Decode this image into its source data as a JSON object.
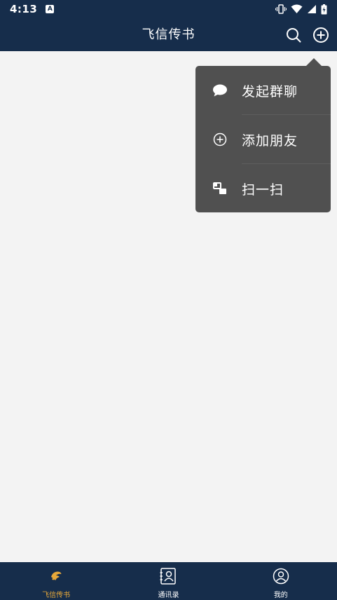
{
  "status_bar": {
    "time": "4:13",
    "notification_icon": "A",
    "icons": [
      "vibrate-icon",
      "wifi-icon",
      "signal-icon",
      "battery-icon"
    ]
  },
  "app_bar": {
    "title": "飞信传书",
    "actions": [
      "search-icon",
      "add-circle-icon"
    ],
    "background": "#162d4b"
  },
  "popup_menu": {
    "background": "#505050",
    "items": [
      {
        "label": "发起群聊",
        "icon": "chat-bubble-icon"
      },
      {
        "label": "添加朋友",
        "icon": "add-circle-icon"
      },
      {
        "label": "扫一扫",
        "icon": "scan-icon"
      }
    ]
  },
  "bottom_nav": {
    "background": "#162d4b",
    "active_color": "#e8a93a",
    "items": [
      {
        "label": "飞信传书",
        "icon": "app-logo-icon",
        "active": true
      },
      {
        "label": "通讯录",
        "icon": "contacts-icon",
        "active": false
      },
      {
        "label": "我的",
        "icon": "profile-icon",
        "active": false
      }
    ]
  }
}
